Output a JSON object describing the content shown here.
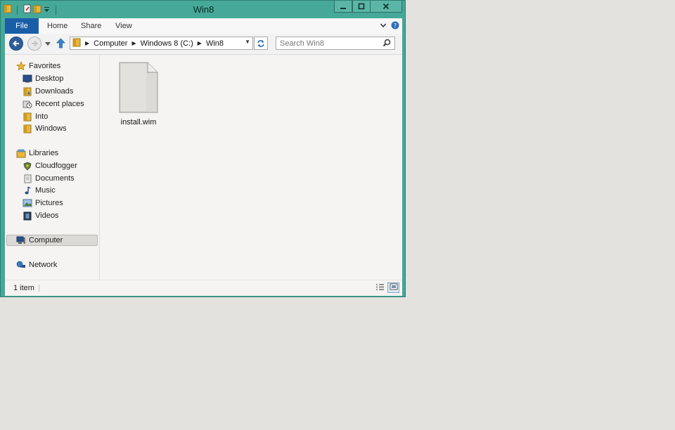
{
  "window": {
    "title": "Win8",
    "accent": "#45a898"
  },
  "ribbon": {
    "tabs": [
      {
        "label": "File"
      },
      {
        "label": "Home"
      },
      {
        "label": "Share"
      },
      {
        "label": "View"
      }
    ]
  },
  "address": {
    "crumbs": [
      "Computer",
      "Windows 8 (C:)",
      "Win8"
    ]
  },
  "search": {
    "placeholder": "Search Win8"
  },
  "sidebar": {
    "favorites": {
      "label": "Favorites",
      "items": [
        {
          "label": "Desktop",
          "icon": "desktop-icon"
        },
        {
          "label": "Downloads",
          "icon": "downloads-folder-icon"
        },
        {
          "label": "Recent places",
          "icon": "recent-places-icon"
        },
        {
          "label": "Into",
          "icon": "folder-icon"
        },
        {
          "label": "Windows",
          "icon": "folder-icon"
        }
      ]
    },
    "libraries": {
      "label": "Libraries",
      "items": [
        {
          "label": "Cloudfogger",
          "icon": "shield-icon"
        },
        {
          "label": "Documents",
          "icon": "documents-icon"
        },
        {
          "label": "Music",
          "icon": "music-note-icon"
        },
        {
          "label": "Pictures",
          "icon": "pictures-icon"
        },
        {
          "label": "Videos",
          "icon": "film-icon"
        }
      ]
    },
    "computer": {
      "label": "Computer"
    },
    "network": {
      "label": "Network"
    }
  },
  "files": [
    {
      "name": "install.wim",
      "icon": "generic-file-icon"
    }
  ],
  "status": {
    "item_count": "1 item"
  }
}
